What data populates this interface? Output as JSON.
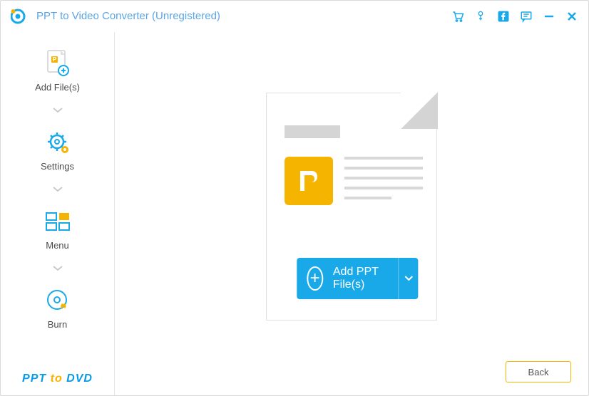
{
  "window": {
    "title": "PPT to Video Converter (Unregistered)"
  },
  "titlebar_icons": {
    "cart": "cart-icon",
    "key": "key-icon",
    "facebook": "facebook-icon",
    "feedback": "feedback-icon",
    "minimize": "minimize-icon",
    "close": "close-icon"
  },
  "sidebar": {
    "items": [
      {
        "label": "Add File(s)",
        "name": "add-files"
      },
      {
        "label": "Settings",
        "name": "settings"
      },
      {
        "label": "Menu",
        "name": "menu"
      },
      {
        "label": "Burn",
        "name": "burn"
      }
    ],
    "brand_left": "PPT ",
    "brand_mid": "to ",
    "brand_right": "DVD"
  },
  "main": {
    "add_button_label": "Add PPT File(s)"
  },
  "footer": {
    "back_label": "Back"
  },
  "colors": {
    "accent_blue": "#19a9e8",
    "accent_yellow": "#f5b400"
  }
}
